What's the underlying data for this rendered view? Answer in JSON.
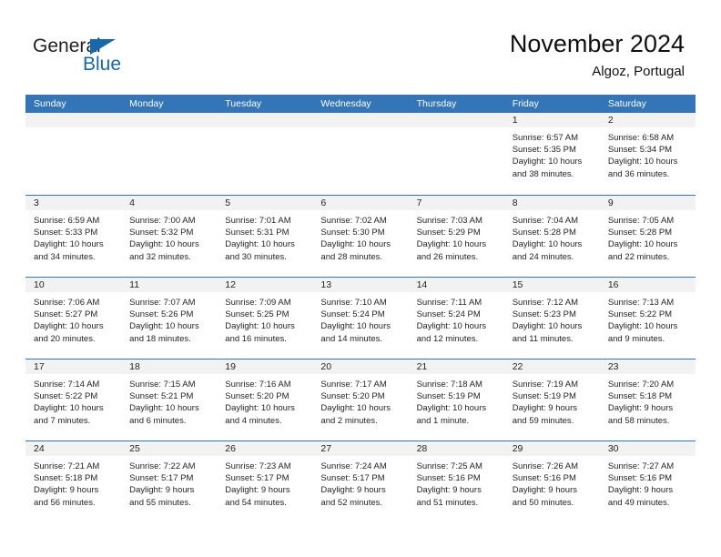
{
  "brand": {
    "name_part1": "General",
    "name_part2": "Blue",
    "accent_color": "#1569b0"
  },
  "header": {
    "month_title": "November 2024",
    "location": "Algoz, Portugal"
  },
  "theme": {
    "header_blue": "#3375b6",
    "day_band_gray": "#f2f2f2",
    "text_color": "#231f20"
  },
  "calendar": {
    "weekdays": [
      "Sunday",
      "Monday",
      "Tuesday",
      "Wednesday",
      "Thursday",
      "Friday",
      "Saturday"
    ],
    "weeks": [
      [
        {
          "day": "",
          "lines": []
        },
        {
          "day": "",
          "lines": []
        },
        {
          "day": "",
          "lines": []
        },
        {
          "day": "",
          "lines": []
        },
        {
          "day": "",
          "lines": []
        },
        {
          "day": "1",
          "lines": [
            "Sunrise: 6:57 AM",
            "Sunset: 5:35 PM",
            "Daylight: 10 hours",
            "and 38 minutes."
          ]
        },
        {
          "day": "2",
          "lines": [
            "Sunrise: 6:58 AM",
            "Sunset: 5:34 PM",
            "Daylight: 10 hours",
            "and 36 minutes."
          ]
        }
      ],
      [
        {
          "day": "3",
          "lines": [
            "Sunrise: 6:59 AM",
            "Sunset: 5:33 PM",
            "Daylight: 10 hours",
            "and 34 minutes."
          ]
        },
        {
          "day": "4",
          "lines": [
            "Sunrise: 7:00 AM",
            "Sunset: 5:32 PM",
            "Daylight: 10 hours",
            "and 32 minutes."
          ]
        },
        {
          "day": "5",
          "lines": [
            "Sunrise: 7:01 AM",
            "Sunset: 5:31 PM",
            "Daylight: 10 hours",
            "and 30 minutes."
          ]
        },
        {
          "day": "6",
          "lines": [
            "Sunrise: 7:02 AM",
            "Sunset: 5:30 PM",
            "Daylight: 10 hours",
            "and 28 minutes."
          ]
        },
        {
          "day": "7",
          "lines": [
            "Sunrise: 7:03 AM",
            "Sunset: 5:29 PM",
            "Daylight: 10 hours",
            "and 26 minutes."
          ]
        },
        {
          "day": "8",
          "lines": [
            "Sunrise: 7:04 AM",
            "Sunset: 5:28 PM",
            "Daylight: 10 hours",
            "and 24 minutes."
          ]
        },
        {
          "day": "9",
          "lines": [
            "Sunrise: 7:05 AM",
            "Sunset: 5:28 PM",
            "Daylight: 10 hours",
            "and 22 minutes."
          ]
        }
      ],
      [
        {
          "day": "10",
          "lines": [
            "Sunrise: 7:06 AM",
            "Sunset: 5:27 PM",
            "Daylight: 10 hours",
            "and 20 minutes."
          ]
        },
        {
          "day": "11",
          "lines": [
            "Sunrise: 7:07 AM",
            "Sunset: 5:26 PM",
            "Daylight: 10 hours",
            "and 18 minutes."
          ]
        },
        {
          "day": "12",
          "lines": [
            "Sunrise: 7:09 AM",
            "Sunset: 5:25 PM",
            "Daylight: 10 hours",
            "and 16 minutes."
          ]
        },
        {
          "day": "13",
          "lines": [
            "Sunrise: 7:10 AM",
            "Sunset: 5:24 PM",
            "Daylight: 10 hours",
            "and 14 minutes."
          ]
        },
        {
          "day": "14",
          "lines": [
            "Sunrise: 7:11 AM",
            "Sunset: 5:24 PM",
            "Daylight: 10 hours",
            "and 12 minutes."
          ]
        },
        {
          "day": "15",
          "lines": [
            "Sunrise: 7:12 AM",
            "Sunset: 5:23 PM",
            "Daylight: 10 hours",
            "and 11 minutes."
          ]
        },
        {
          "day": "16",
          "lines": [
            "Sunrise: 7:13 AM",
            "Sunset: 5:22 PM",
            "Daylight: 10 hours",
            "and 9 minutes."
          ]
        }
      ],
      [
        {
          "day": "17",
          "lines": [
            "Sunrise: 7:14 AM",
            "Sunset: 5:22 PM",
            "Daylight: 10 hours",
            "and 7 minutes."
          ]
        },
        {
          "day": "18",
          "lines": [
            "Sunrise: 7:15 AM",
            "Sunset: 5:21 PM",
            "Daylight: 10 hours",
            "and 6 minutes."
          ]
        },
        {
          "day": "19",
          "lines": [
            "Sunrise: 7:16 AM",
            "Sunset: 5:20 PM",
            "Daylight: 10 hours",
            "and 4 minutes."
          ]
        },
        {
          "day": "20",
          "lines": [
            "Sunrise: 7:17 AM",
            "Sunset: 5:20 PM",
            "Daylight: 10 hours",
            "and 2 minutes."
          ]
        },
        {
          "day": "21",
          "lines": [
            "Sunrise: 7:18 AM",
            "Sunset: 5:19 PM",
            "Daylight: 10 hours",
            "and 1 minute."
          ]
        },
        {
          "day": "22",
          "lines": [
            "Sunrise: 7:19 AM",
            "Sunset: 5:19 PM",
            "Daylight: 9 hours",
            "and 59 minutes."
          ]
        },
        {
          "day": "23",
          "lines": [
            "Sunrise: 7:20 AM",
            "Sunset: 5:18 PM",
            "Daylight: 9 hours",
            "and 58 minutes."
          ]
        }
      ],
      [
        {
          "day": "24",
          "lines": [
            "Sunrise: 7:21 AM",
            "Sunset: 5:18 PM",
            "Daylight: 9 hours",
            "and 56 minutes."
          ]
        },
        {
          "day": "25",
          "lines": [
            "Sunrise: 7:22 AM",
            "Sunset: 5:17 PM",
            "Daylight: 9 hours",
            "and 55 minutes."
          ]
        },
        {
          "day": "26",
          "lines": [
            "Sunrise: 7:23 AM",
            "Sunset: 5:17 PM",
            "Daylight: 9 hours",
            "and 54 minutes."
          ]
        },
        {
          "day": "27",
          "lines": [
            "Sunrise: 7:24 AM",
            "Sunset: 5:17 PM",
            "Daylight: 9 hours",
            "and 52 minutes."
          ]
        },
        {
          "day": "28",
          "lines": [
            "Sunrise: 7:25 AM",
            "Sunset: 5:16 PM",
            "Daylight: 9 hours",
            "and 51 minutes."
          ]
        },
        {
          "day": "29",
          "lines": [
            "Sunrise: 7:26 AM",
            "Sunset: 5:16 PM",
            "Daylight: 9 hours",
            "and 50 minutes."
          ]
        },
        {
          "day": "30",
          "lines": [
            "Sunrise: 7:27 AM",
            "Sunset: 5:16 PM",
            "Daylight: 9 hours",
            "and 49 minutes."
          ]
        }
      ]
    ]
  }
}
